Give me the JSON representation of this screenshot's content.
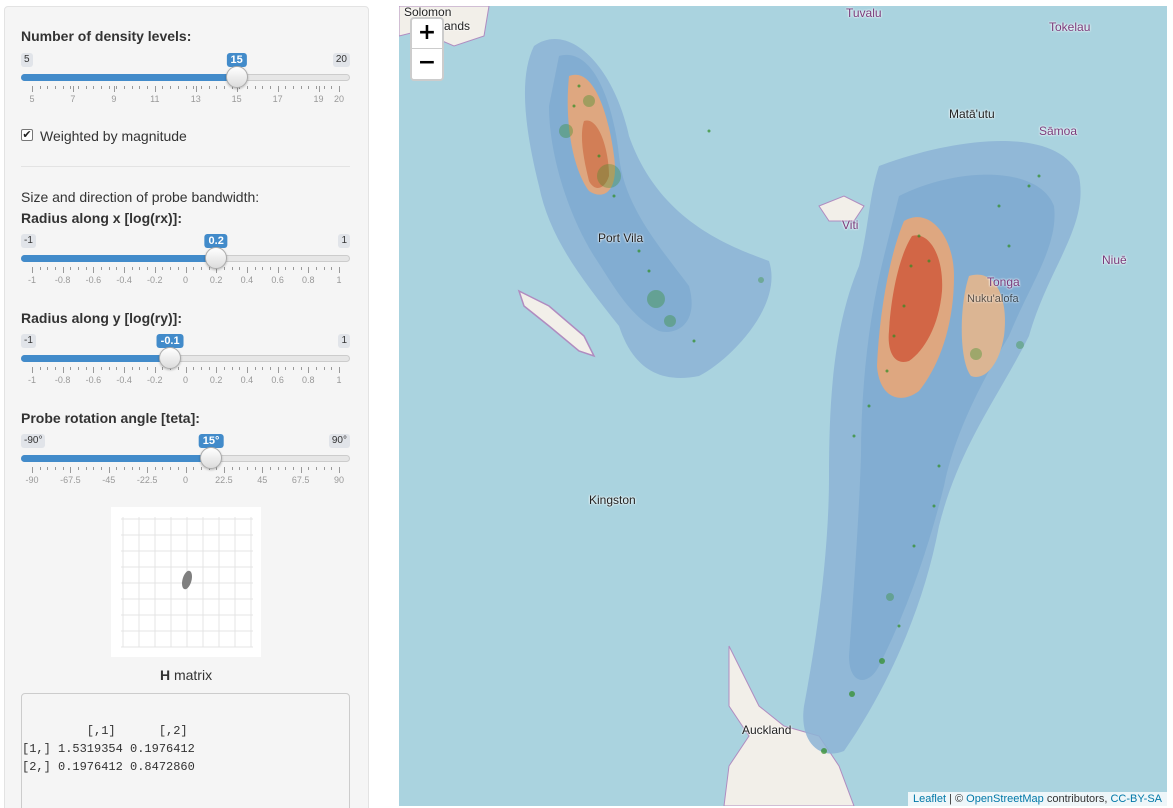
{
  "density": {
    "label": "Number of density levels:",
    "min": "5",
    "max": "20",
    "value": "15",
    "fraction": 0.6667,
    "ticks": [
      "5",
      "7",
      "9",
      "11",
      "13",
      "15",
      "17",
      "19",
      "20"
    ]
  },
  "weighted": {
    "label": "Weighted by magnitude",
    "checked": true,
    "check_glyph": "✔"
  },
  "bandwidth": {
    "intro": "Size and direction of probe bandwidth:"
  },
  "rx": {
    "label": "Radius along x [log(rx)]:",
    "min": "-1",
    "max": "1",
    "value": "0.2",
    "fraction": 0.6,
    "ticks": [
      "-1",
      "-0.8",
      "-0.6",
      "-0.4",
      "-0.2",
      "0",
      "0.2",
      "0.4",
      "0.6",
      "0.8",
      "1"
    ]
  },
  "ry": {
    "label": "Radius along y [log(ry)]:",
    "min": "-1",
    "max": "1",
    "value": "-0.1",
    "fraction": 0.45,
    "ticks": [
      "-1",
      "-0.8",
      "-0.6",
      "-0.4",
      "-0.2",
      "0",
      "0.2",
      "0.4",
      "0.6",
      "0.8",
      "1"
    ]
  },
  "teta": {
    "label": "Probe rotation angle [teta]:",
    "min": "-90°",
    "max": "90°",
    "value": "15°",
    "fraction": 0.5833,
    "ticks": [
      "-90",
      "-67.5",
      "-45",
      "-22.5",
      "0",
      "22.5",
      "45",
      "67.5",
      "90"
    ]
  },
  "hmatrix": {
    "caption_bold": "H",
    "caption_rest": " matrix",
    "lines": [
      "         [,1]      [,2]",
      "[1,] 1.5319354 0.1976412",
      "[2,] 0.1976412 0.8472860"
    ]
  },
  "map": {
    "zoom_in": "+",
    "zoom_out": "−",
    "places": {
      "solomon": "Solomon",
      "islands": "Islands",
      "tuvalu": "Tuvalu",
      "tokelau": "Tokelau",
      "mataatu": "Matā'utu",
      "samoa": "Sāmoa",
      "viti": "Viti",
      "niue": "Niuē",
      "tonga": "Tonga",
      "nukualofa": "Nuku'alofa",
      "portvila": "Port Vila",
      "kingston": "Kingston",
      "auckland": "Auckland"
    },
    "attribution": {
      "leaflet": "Leaflet",
      "sep": " | © ",
      "osm": "OpenStreetMap",
      "contrib": " contributors, ",
      "license": "CC-BY-SA"
    },
    "colors": {
      "sea": "#aad3df",
      "density_low": "#6a9fcc",
      "density_high": "#d9532c",
      "quake_points": "#2e8b22"
    }
  }
}
